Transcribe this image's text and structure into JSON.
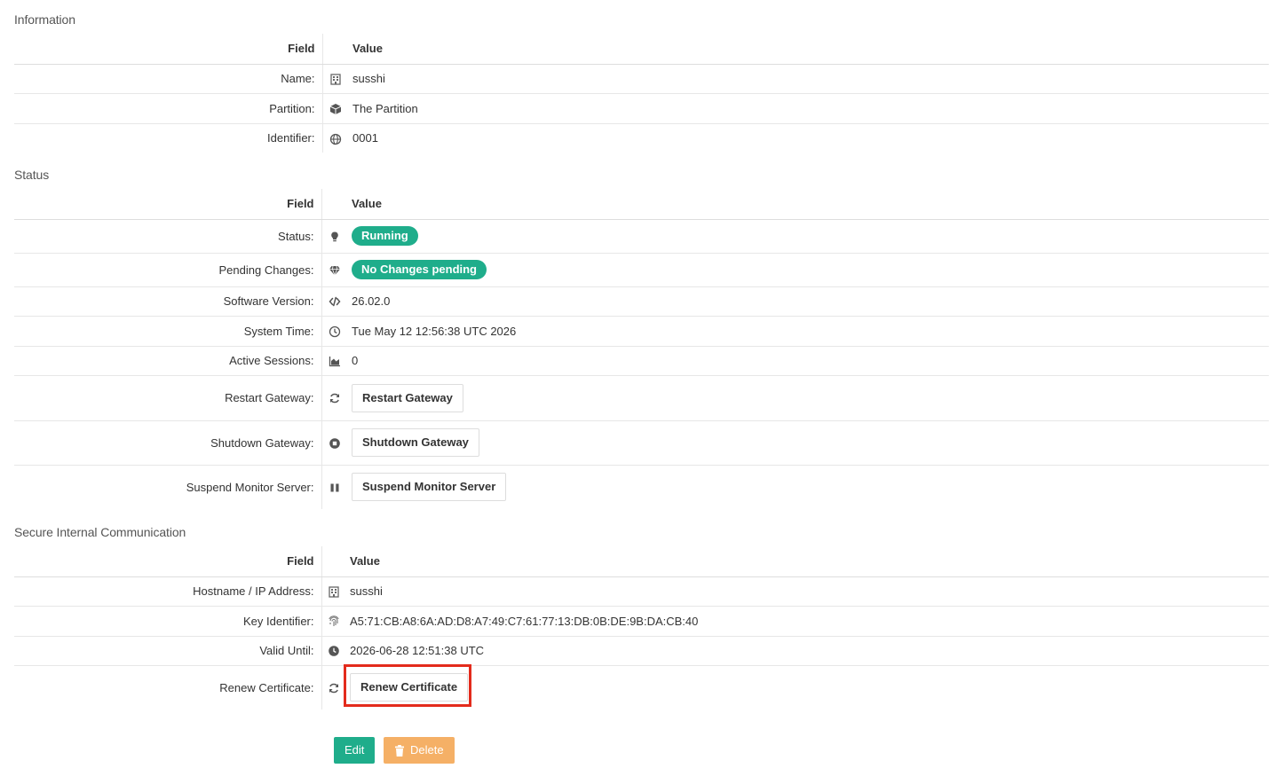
{
  "information": {
    "title": "Information",
    "header_field": "Field",
    "header_value": "Value",
    "rows": [
      {
        "label": "Name:",
        "icon": "building-icon",
        "value": "susshi"
      },
      {
        "label": "Partition:",
        "icon": "cube-icon",
        "value": "The Partition"
      },
      {
        "label": "Identifier:",
        "icon": "globe-icon",
        "value": "0001"
      }
    ]
  },
  "status": {
    "title": "Status",
    "header_field": "Field",
    "header_value": "Value",
    "rows": [
      {
        "label": "Status:",
        "icon": "lightbulb-icon",
        "value": "Running",
        "type": "badge"
      },
      {
        "label": "Pending Changes:",
        "icon": "diamond-icon",
        "value": "No Changes pending",
        "type": "badge"
      },
      {
        "label": "Software Version:",
        "icon": "code-icon",
        "value": "26.02.0"
      },
      {
        "label": "System Time:",
        "icon": "clock-icon",
        "value": "Tue May 12 12:56:38 UTC 2026"
      },
      {
        "label": "Active Sessions:",
        "icon": "area-chart-icon",
        "value": "0"
      },
      {
        "label": "Restart Gateway:",
        "icon": "refresh-icon",
        "value": "Restart Gateway",
        "type": "button"
      },
      {
        "label": "Shutdown Gateway:",
        "icon": "stop-circle-icon",
        "value": "Shutdown Gateway",
        "type": "button"
      },
      {
        "label": "Suspend Monitor Server:",
        "icon": "pause-icon",
        "value": "Suspend Monitor Server",
        "type": "button"
      }
    ]
  },
  "secure": {
    "title": "Secure Internal Communication",
    "header_field": "Field",
    "header_value": "Value",
    "rows": [
      {
        "label": "Hostname / IP Address:",
        "icon": "building-icon",
        "value": "susshi"
      },
      {
        "label": "Key Identifier:",
        "icon": "fingerprint-icon",
        "value": "A5:71:CB:A8:6A:AD:D8:A7:49:C7:61:77:13:DB:0B:DE:9B:DA:CB:40"
      },
      {
        "label": "Valid Until:",
        "icon": "clock-solid-icon",
        "value": "2026-06-28 12:51:38 UTC"
      },
      {
        "label": "Renew Certificate:",
        "icon": "refresh-icon",
        "value": "Renew Certificate",
        "type": "button"
      }
    ]
  },
  "actions": {
    "edit_label": "Edit",
    "delete_label": "Delete"
  },
  "colors": {
    "accent": "#1fad8b",
    "warning": "#f5b066",
    "highlight": "#e32b1c"
  }
}
